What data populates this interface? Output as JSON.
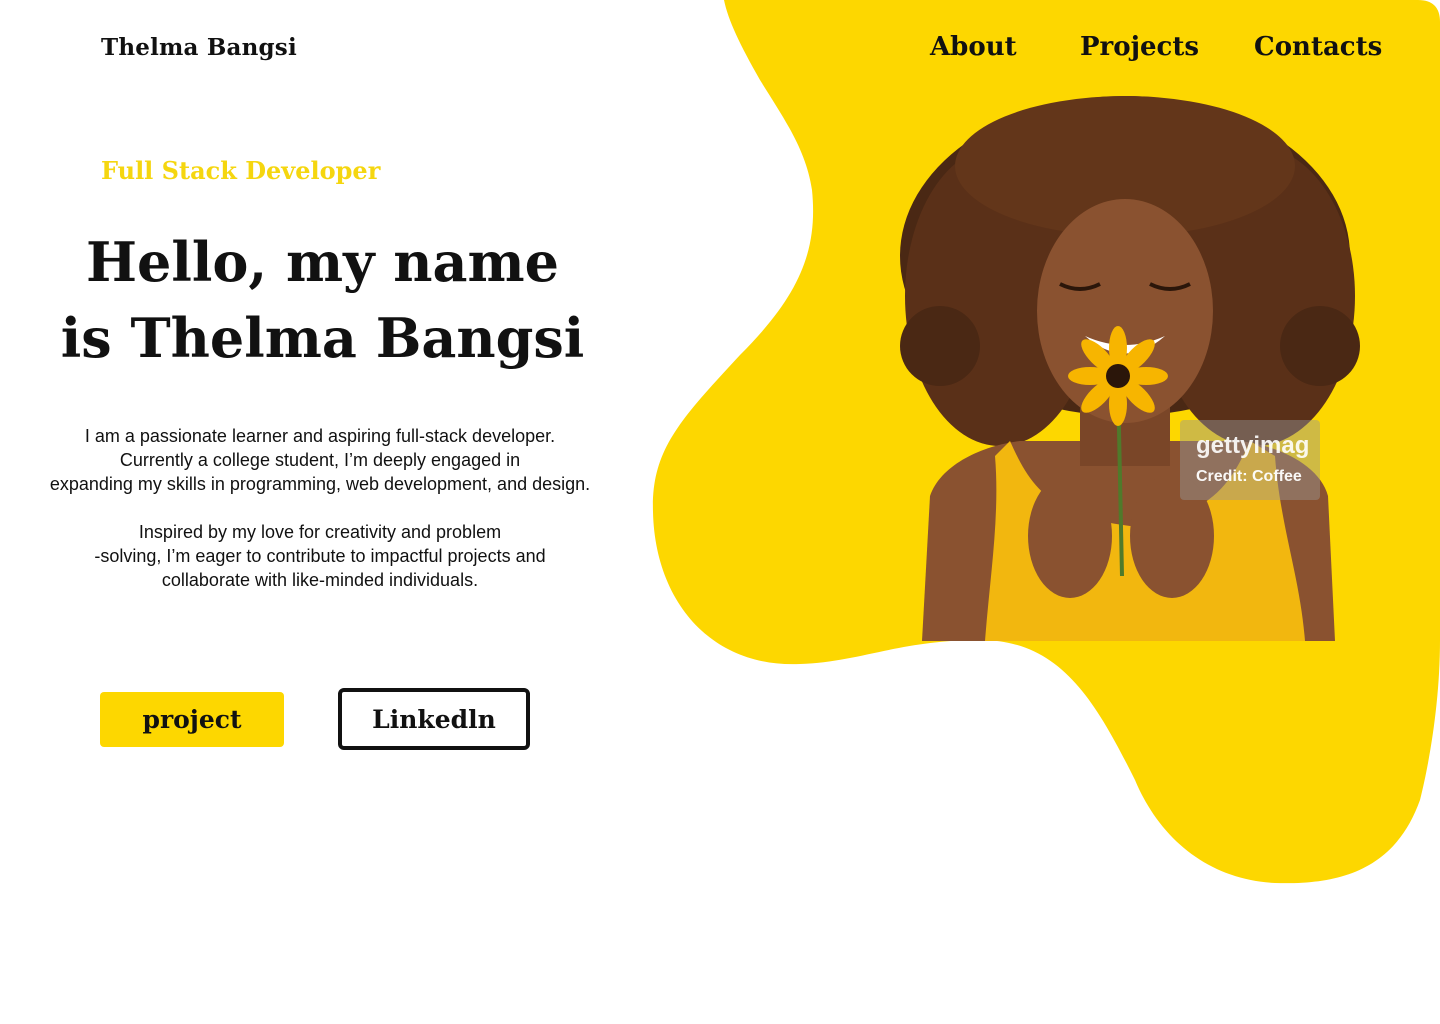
{
  "brand": {
    "name": "Thelma Bangsi",
    "accent_color": "#fdd700",
    "text_color": "#111111"
  },
  "nav": {
    "items": [
      {
        "label": "About"
      },
      {
        "label": "Projects"
      },
      {
        "label": "Contacts"
      }
    ]
  },
  "hero": {
    "role": "Full Stack Developer",
    "title_line1": "Hello, my name",
    "title_line2": "is Thelma Bangsi",
    "bio": {
      "p1_l1": "I am a passionate learner and aspiring full-stack developer.",
      "p1_l2": "Currently a college student, I’m deeply engaged in",
      "p1_l3": "expanding my skills in programming, web development, and design.",
      "p2_l1": "Inspired by my love for creativity and problem",
      "p2_l2": "-solving, I’m eager to contribute to impactful projects and",
      "p2_l3": "collaborate with like-minded individuals."
    },
    "buttons": {
      "project_label": "project",
      "linkedin_label": "Linkedln"
    }
  },
  "photo": {
    "watermark_brand": "gettyimag",
    "watermark_credit": "Credit: Coffee"
  }
}
